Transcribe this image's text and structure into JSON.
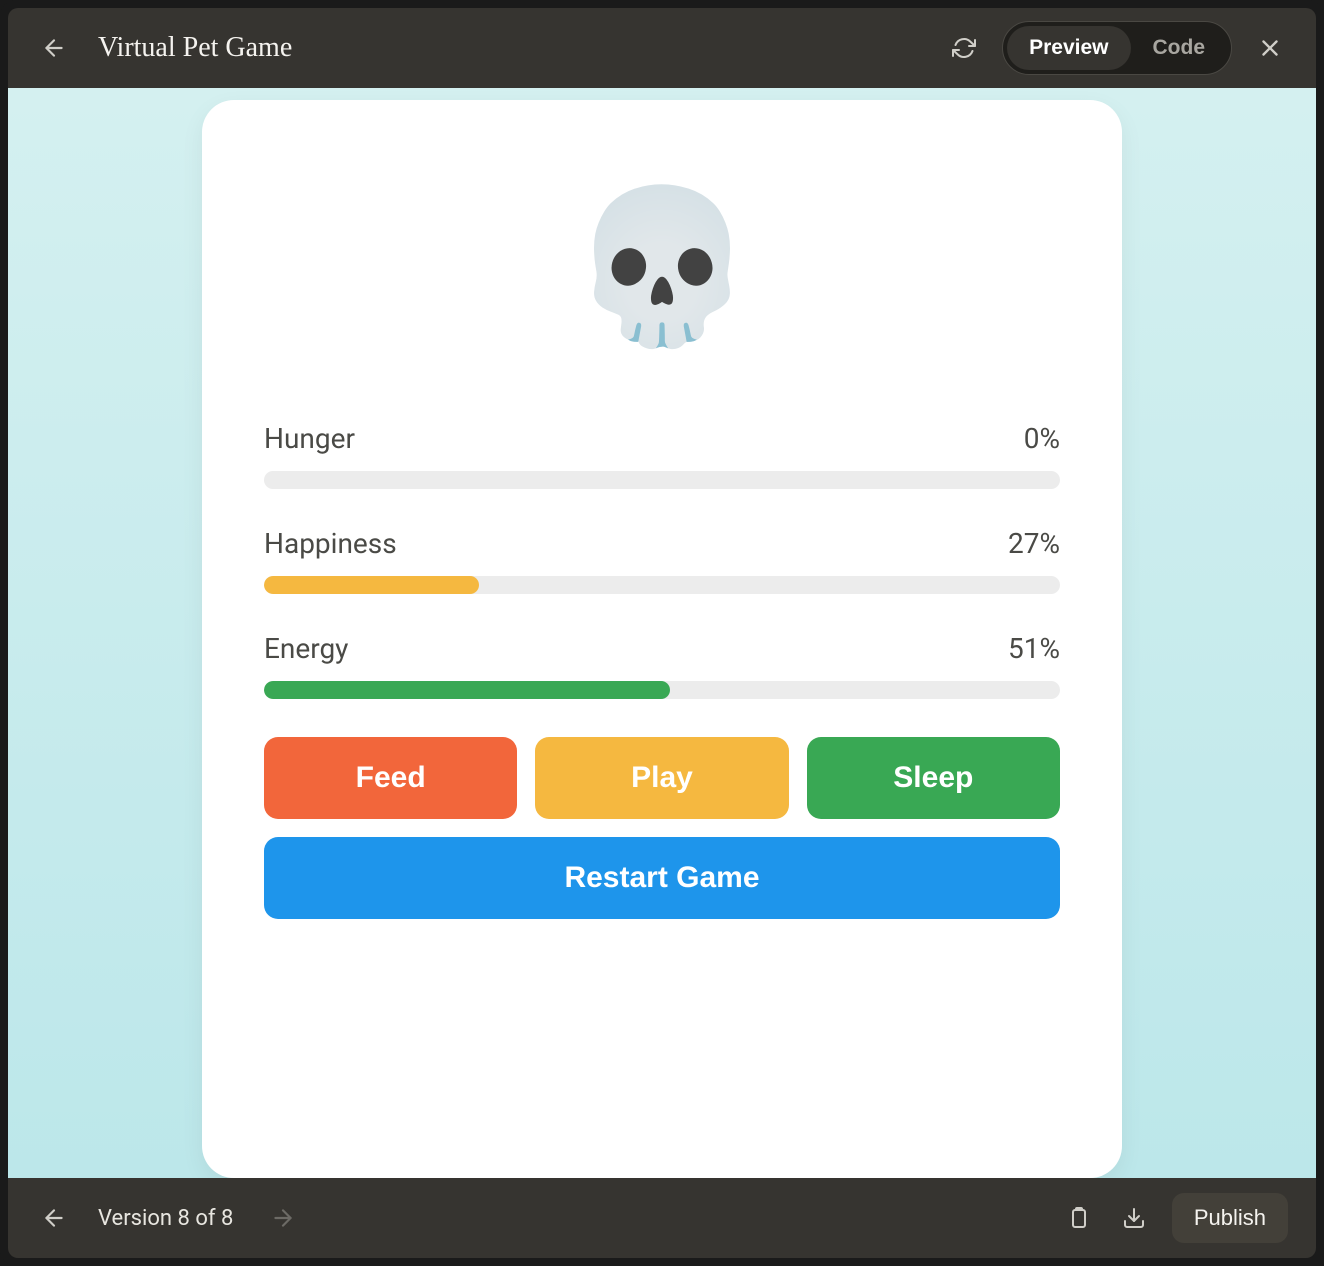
{
  "header": {
    "title": "Virtual Pet Game",
    "tabs": {
      "preview": "Preview",
      "code": "Code",
      "active": "preview"
    }
  },
  "pet": {
    "emoji": "💀"
  },
  "stats": [
    {
      "label": "Hunger",
      "value": 0,
      "display": "0%",
      "color": "#f5b840"
    },
    {
      "label": "Happiness",
      "value": 27,
      "display": "27%",
      "color": "#f5b840"
    },
    {
      "label": "Energy",
      "value": 51,
      "display": "51%",
      "color": "#39a854"
    }
  ],
  "actions": {
    "feed": {
      "label": "Feed",
      "color": "#f2663b"
    },
    "play": {
      "label": "Play",
      "color": "#f5b840"
    },
    "sleep": {
      "label": "Sleep",
      "color": "#39a854"
    }
  },
  "restart": {
    "label": "Restart Game",
    "color": "#1e95eb"
  },
  "footer": {
    "version_label": "Version 8 of 8",
    "publish_label": "Publish"
  }
}
